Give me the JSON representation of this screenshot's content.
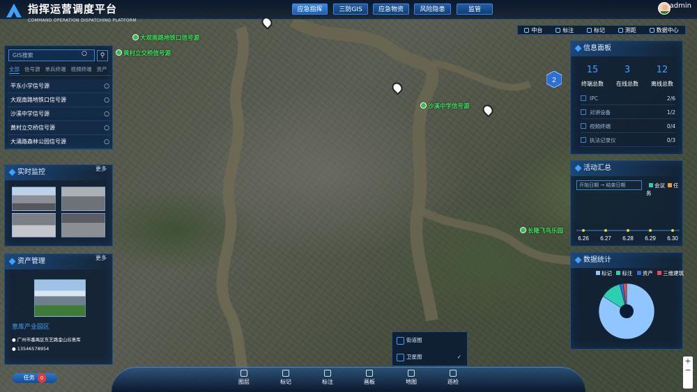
{
  "app": {
    "title": "指挥运营调度平台",
    "subtitle": "COMMAND OPERATION DISPATCHING PLATFORM",
    "user": "admin"
  },
  "nav": [
    {
      "label": "应急指挥",
      "active": true
    },
    {
      "label": "三防GIS"
    },
    {
      "label": "应急物资"
    },
    {
      "label": "风险隐患"
    },
    {
      "label": "监管"
    }
  ],
  "toolstrip": [
    "中台",
    "标注",
    "标记",
    "测距",
    "数据中心"
  ],
  "gis": {
    "placeholder": "GIS搜索",
    "tabs": [
      "全部",
      "信号源",
      "单兵终端",
      "视频终端",
      "资产"
    ],
    "items": [
      "平东小学信号源",
      "大观南路地铁口信号源",
      "沙溪中学信号源",
      "黄村立交桥信号源",
      "大涌路森林公园信号源"
    ]
  },
  "live": {
    "title": "实时监控",
    "more": "更多"
  },
  "asset": {
    "title": "资产管理",
    "more": "更多",
    "name": "意库产业园区",
    "address": "广州市番禺区东艺路金山谷意库",
    "phone": "13546578954"
  },
  "info": {
    "title": "信息面板",
    "stats": [
      {
        "value": "15",
        "label": "终端总数"
      },
      {
        "value": "3",
        "label": "在线总数"
      },
      {
        "value": "12",
        "label": "离线总数"
      }
    ],
    "rows": [
      {
        "label": "IPC",
        "value": "2/6"
      },
      {
        "label": "对讲设备",
        "value": "1/2"
      },
      {
        "label": "视频终端",
        "value": "0/4"
      },
      {
        "label": "执法记录仪",
        "value": "0/3"
      }
    ]
  },
  "activity": {
    "title": "活动汇总",
    "start": "开始日期",
    "end": "结束日期",
    "legend": [
      "会议",
      "任务"
    ]
  },
  "datastat": {
    "title": "数据统计",
    "legend": [
      "标记",
      "标注",
      "资产",
      "三维建筑"
    ]
  },
  "map_labels": {
    "l1": "大观南路地铁口信号源",
    "l2": "黄村立交桥信号源",
    "l3": "沙溪中学信号源",
    "l4": "长隆飞鸟乐园",
    "cluster": "2"
  },
  "layer": {
    "items": [
      "街道图",
      "卫星图"
    ]
  },
  "bottom": [
    "图层",
    "标记",
    "标注",
    "画板",
    "地图",
    "巡检"
  ],
  "task": {
    "label": "任务",
    "count": "0"
  },
  "chart_data": [
    {
      "type": "bar",
      "categories": [
        "6.26",
        "6.27",
        "6.28",
        "6.29",
        "6.30"
      ],
      "series": [
        {
          "name": "会议",
          "values": [
            0,
            0,
            0,
            0,
            0
          ]
        },
        {
          "name": "任务",
          "values": [
            0,
            0,
            0,
            0,
            0
          ]
        }
      ],
      "colors": [
        "#2ad0b0",
        "#e8a23a"
      ]
    },
    {
      "type": "pie",
      "categories": [
        "标记",
        "标注",
        "资产",
        "三维建筑"
      ],
      "values": [
        84,
        12,
        2,
        2
      ],
      "colors": [
        "#8fc6ff",
        "#2ad0b0",
        "#2c6fd6",
        "#e84a4a"
      ]
    }
  ]
}
